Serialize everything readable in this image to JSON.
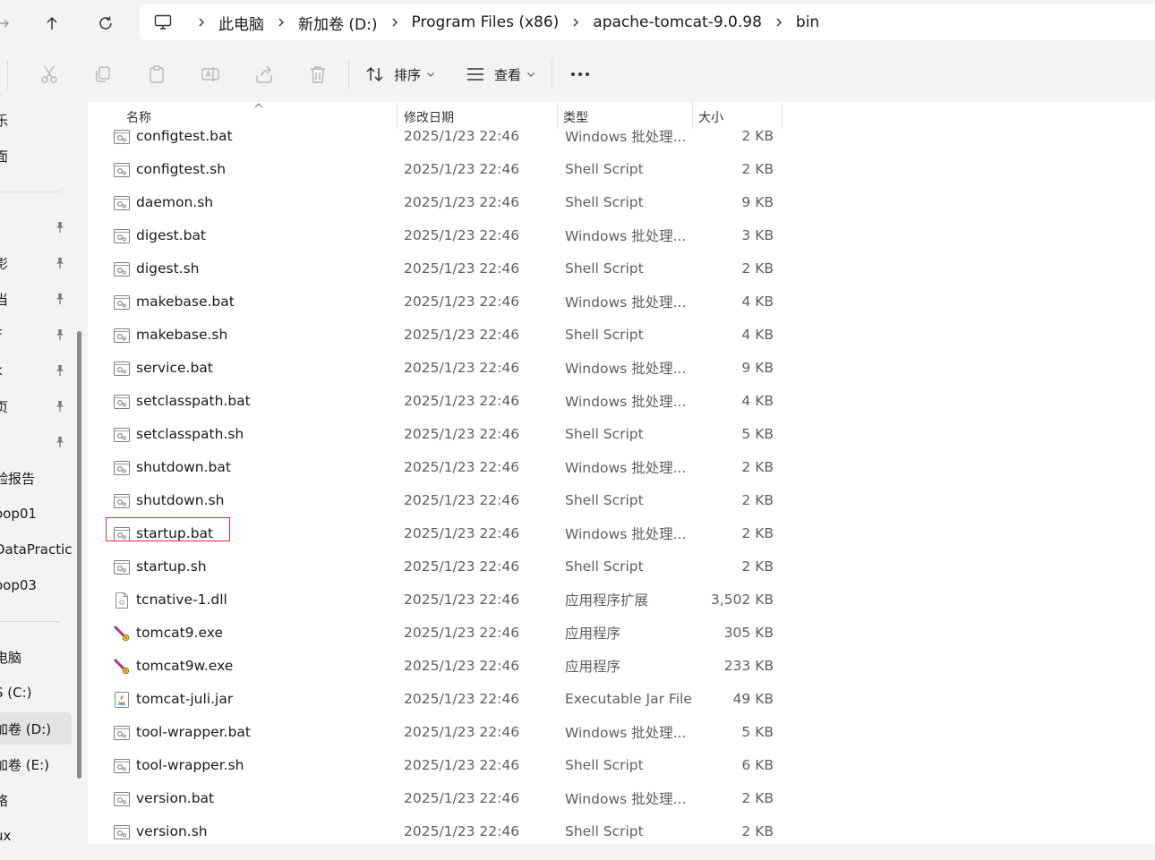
{
  "breadcrumbs": [
    "此电脑",
    "新加卷 (D:)",
    "Program Files (x86)",
    "apache-tomcat-9.0.98",
    "bin"
  ],
  "toolbar": {
    "sort_label": "排序",
    "view_label": "查看"
  },
  "sidebar": {
    "items": [
      {
        "label": "乐",
        "pinned": false
      },
      {
        "label": "面",
        "pinned": false
      },
      {
        "label": "i",
        "pinned": true
      },
      {
        "label": "影",
        "pinned": true
      },
      {
        "label": "当",
        "pinned": true
      },
      {
        "label": "F",
        "pinned": true
      },
      {
        "label": "k",
        "pinned": true
      },
      {
        "label": "页",
        "pinned": true
      },
      {
        "label": "",
        "pinned": true
      },
      {
        "label": "验报告",
        "pinned": false
      },
      {
        "label": "oop01",
        "pinned": false
      },
      {
        "label": "DataPractic",
        "pinned": false
      },
      {
        "label": "oop03",
        "pinned": false
      },
      {
        "label": "电脑",
        "pinned": false
      },
      {
        "label": "S (C:)",
        "pinned": false
      },
      {
        "label": "加卷 (D:)",
        "pinned": false,
        "selected": true
      },
      {
        "label": "加卷 (E:)",
        "pinned": false
      },
      {
        "label": "络",
        "pinned": false
      },
      {
        "label": "ux",
        "pinned": false
      }
    ]
  },
  "columns": {
    "name": "名称",
    "modified": "修改日期",
    "type": "类型",
    "size": "大小"
  },
  "files": [
    {
      "name": "configtest.bat",
      "date": "2025/1/23 22:46",
      "type": "Windows 批处理...",
      "size": "2 KB",
      "icon": "batch-file-icon"
    },
    {
      "name": "configtest.sh",
      "date": "2025/1/23 22:46",
      "type": "Shell Script",
      "size": "2 KB",
      "icon": "script-file-icon"
    },
    {
      "name": "daemon.sh",
      "date": "2025/1/23 22:46",
      "type": "Shell Script",
      "size": "9 KB",
      "icon": "script-file-icon"
    },
    {
      "name": "digest.bat",
      "date": "2025/1/23 22:46",
      "type": "Windows 批处理...",
      "size": "3 KB",
      "icon": "batch-file-icon"
    },
    {
      "name": "digest.sh",
      "date": "2025/1/23 22:46",
      "type": "Shell Script",
      "size": "2 KB",
      "icon": "script-file-icon"
    },
    {
      "name": "makebase.bat",
      "date": "2025/1/23 22:46",
      "type": "Windows 批处理...",
      "size": "4 KB",
      "icon": "batch-file-icon"
    },
    {
      "name": "makebase.sh",
      "date": "2025/1/23 22:46",
      "type": "Shell Script",
      "size": "4 KB",
      "icon": "script-file-icon"
    },
    {
      "name": "service.bat",
      "date": "2025/1/23 22:46",
      "type": "Windows 批处理...",
      "size": "9 KB",
      "icon": "batch-file-icon"
    },
    {
      "name": "setclasspath.bat",
      "date": "2025/1/23 22:46",
      "type": "Windows 批处理...",
      "size": "4 KB",
      "icon": "batch-file-icon"
    },
    {
      "name": "setclasspath.sh",
      "date": "2025/1/23 22:46",
      "type": "Shell Script",
      "size": "5 KB",
      "icon": "script-file-icon"
    },
    {
      "name": "shutdown.bat",
      "date": "2025/1/23 22:46",
      "type": "Windows 批处理...",
      "size": "2 KB",
      "icon": "batch-file-icon"
    },
    {
      "name": "shutdown.sh",
      "date": "2025/1/23 22:46",
      "type": "Shell Script",
      "size": "2 KB",
      "icon": "script-file-icon"
    },
    {
      "name": "startup.bat",
      "date": "2025/1/23 22:46",
      "type": "Windows 批处理...",
      "size": "2 KB",
      "icon": "batch-file-icon",
      "highlighted": true
    },
    {
      "name": "startup.sh",
      "date": "2025/1/23 22:46",
      "type": "Shell Script",
      "size": "2 KB",
      "icon": "script-file-icon"
    },
    {
      "name": "tcnative-1.dll",
      "date": "2025/1/23 22:46",
      "type": "应用程序扩展",
      "size": "3,502 KB",
      "icon": "dll-file-icon"
    },
    {
      "name": "tomcat9.exe",
      "date": "2025/1/23 22:46",
      "type": "应用程序",
      "size": "305 KB",
      "icon": "tomcat-exe-icon"
    },
    {
      "name": "tomcat9w.exe",
      "date": "2025/1/23 22:46",
      "type": "应用程序",
      "size": "233 KB",
      "icon": "tomcat-exe-icon"
    },
    {
      "name": "tomcat-juli.jar",
      "date": "2025/1/23 22:46",
      "type": "Executable Jar File",
      "size": "49 KB",
      "icon": "java-jar-icon"
    },
    {
      "name": "tool-wrapper.bat",
      "date": "2025/1/23 22:46",
      "type": "Windows 批处理...",
      "size": "5 KB",
      "icon": "batch-file-icon"
    },
    {
      "name": "tool-wrapper.sh",
      "date": "2025/1/23 22:46",
      "type": "Shell Script",
      "size": "6 KB",
      "icon": "script-file-icon"
    },
    {
      "name": "version.bat",
      "date": "2025/1/23 22:46",
      "type": "Windows 批处理...",
      "size": "2 KB",
      "icon": "batch-file-icon"
    },
    {
      "name": "version.sh",
      "date": "2025/1/23 22:46",
      "type": "Shell Script",
      "size": "2 KB",
      "icon": "script-file-icon"
    }
  ],
  "colors": {
    "chrome_bg": "#f3f3f3",
    "highlight_border": "#e0303a",
    "muted_text": "#5f5f5f"
  }
}
